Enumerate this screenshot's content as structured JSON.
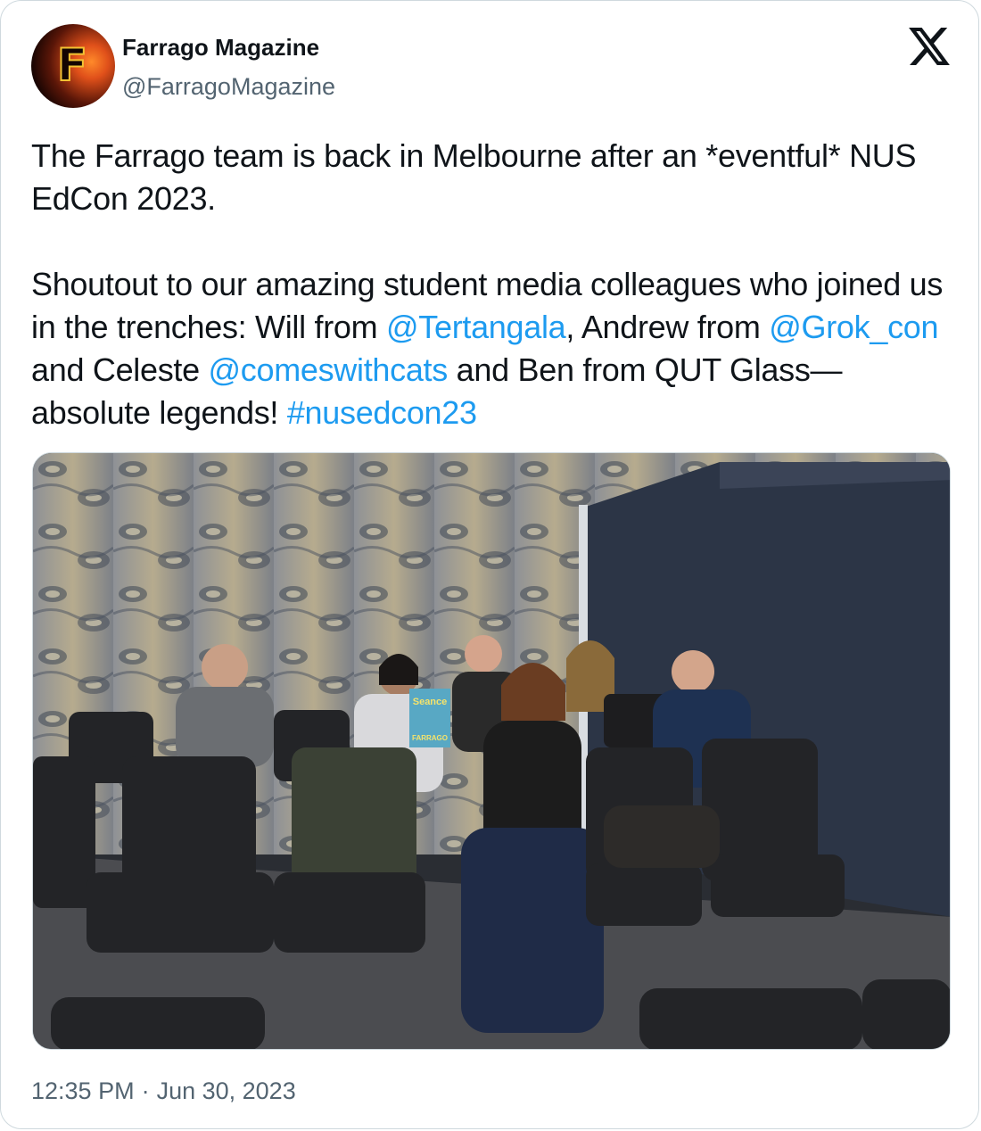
{
  "author": {
    "display_name": "Farrago Magazine",
    "handle": "@FarragoMagazine",
    "avatar_letter": "F"
  },
  "brand_icon": "x-logo-icon",
  "tweet": {
    "line1_text": "The Farrago team is back in Melbourne after an *eventful* NUS EdCon 2023.",
    "p2_a": "Shoutout to our amazing student media colleagues who joined us in the trenches: Will from ",
    "mention_1": "@Tertangala",
    "p2_b": ", Andrew from ",
    "mention_2": "@Grok_con",
    "p2_c": " and Celeste ",
    "mention_3": "@comeswithcats",
    "p2_d": " and Ben from QUT Glass—absolute legends! ",
    "hashtag": "#nusedcon23"
  },
  "media": {
    "cover_text_1": "Seance",
    "cover_text_2": "FARRAGO"
  },
  "meta": {
    "time": "12:35 PM",
    "separator": "·",
    "date": "Jun 30, 2023"
  },
  "colors": {
    "link": "#1d9bf0",
    "text": "#0f1419",
    "secondary": "#536471",
    "border": "#cfd9de"
  }
}
